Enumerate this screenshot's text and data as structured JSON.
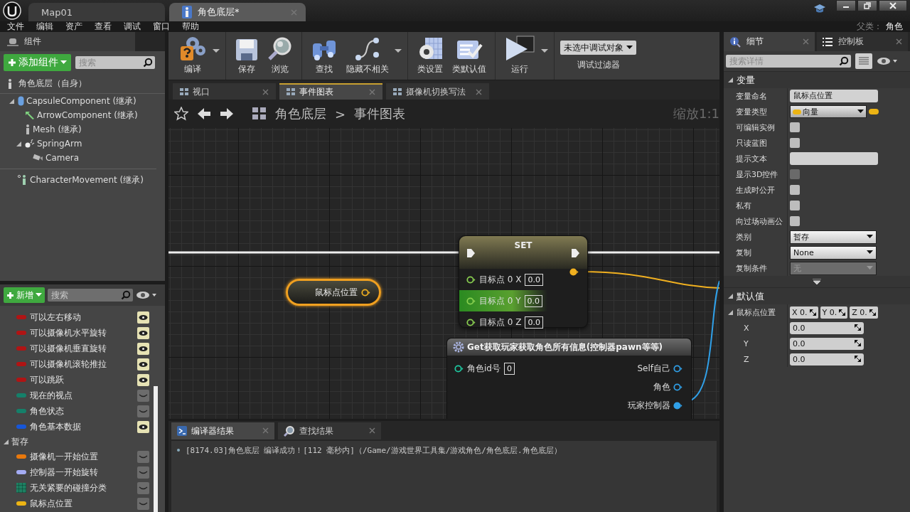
{
  "title_bar": {
    "tabs": [
      {
        "label": "Map01",
        "selected": false
      },
      {
        "label": "角色底层*",
        "selected": true
      }
    ]
  },
  "menu": {
    "items": [
      "文件",
      "编辑",
      "资产",
      "查看",
      "调试",
      "窗口",
      "帮助"
    ],
    "parent_label": "父类：",
    "parent_value": "角色"
  },
  "components": {
    "tab": "组件",
    "add_button": "添加组件",
    "search": {
      "placeholder": "搜索"
    },
    "root": "角色底层（自身）",
    "tree": [
      {
        "label": "CapsuleComponent (继承)",
        "expanded": true,
        "children": [
          {
            "label": "ArrowComponent (继承)"
          },
          {
            "label": "Mesh (继承)"
          },
          {
            "label": "SpringArm",
            "expanded": true,
            "children": [
              {
                "label": "Camera"
              }
            ]
          }
        ]
      },
      {
        "label": "CharacterMovement (继承)"
      }
    ]
  },
  "my_blueprint": {
    "add_button": "新增",
    "search": {
      "placeholder": "搜索"
    },
    "variables": [
      {
        "label": "可以左右移动",
        "kind": "pill",
        "color": "#b01414",
        "visible": true
      },
      {
        "label": "可以摄像机水平旋转",
        "kind": "pill",
        "color": "#b01414",
        "visible": true
      },
      {
        "label": "可以摄像机垂直旋转",
        "kind": "pill",
        "color": "#b01414",
        "visible": true
      },
      {
        "label": "可以摄像机滚轮推拉",
        "kind": "pill",
        "color": "#b01414",
        "visible": true
      },
      {
        "label": "可以跳跃",
        "kind": "pill",
        "color": "#b01414",
        "visible": true
      },
      {
        "label": "现在的视点",
        "kind": "pill",
        "color": "#15806a",
        "visible": false
      },
      {
        "label": "角色状态",
        "kind": "pill",
        "color": "#15806a",
        "visible": false
      },
      {
        "label": "角色基本数据",
        "kind": "pill",
        "color": "#1656d8",
        "visible": true
      }
    ],
    "categories": [
      {
        "label": "暂存",
        "expanded": true,
        "variables": [
          {
            "label": "摄像机一开始位置",
            "kind": "pill",
            "color": "#e8780c",
            "visible": false
          },
          {
            "label": "控制器一开始旋转",
            "kind": "pill",
            "color": "#a4acf4",
            "visible": false
          },
          {
            "label": "无关紧要的碰撞分类",
            "kind": "grid",
            "color": "#1e8062",
            "visible": false
          },
          {
            "label": "鼠标点位置",
            "kind": "pill",
            "color": "#ecb414",
            "visible": false
          }
        ]
      }
    ]
  },
  "toolbar": {
    "groups": [
      {
        "buttons": [
          {
            "label": "编译",
            "has_menu": true
          }
        ]
      },
      {
        "buttons": [
          {
            "label": "保存",
            "has_menu": false
          },
          {
            "label": "浏览",
            "has_menu": false
          }
        ]
      },
      {
        "buttons": [
          {
            "label": "查找",
            "has_menu": false
          },
          {
            "label": "隐藏不相关",
            "has_menu": true
          }
        ]
      },
      {
        "buttons": [
          {
            "label": "类设置",
            "has_menu": false
          },
          {
            "label": "类默认值",
            "has_menu": false
          }
        ]
      },
      {
        "buttons": [
          {
            "label": "运行",
            "has_menu": true
          }
        ]
      }
    ],
    "debug_filter": {
      "value": "未选中调试对象",
      "label": "调试过滤器"
    }
  },
  "doc_tabs": [
    {
      "label": "视口",
      "selected": false
    },
    {
      "label": "事件图表",
      "selected": true
    },
    {
      "label": "摄像机切换写法",
      "selected": false
    }
  ],
  "graph": {
    "breadcrumb": [
      "角色底层",
      "事件图表"
    ],
    "separator": ">",
    "zoom": "缩放1:1",
    "nodes": [
      {
        "kind": "variable",
        "title": "鼠标点位置",
        "selected": true
      },
      {
        "kind": "set",
        "title": "SET",
        "selected": false,
        "inputs": [
          {
            "label": "目标点 0 X",
            "value": "0.0",
            "hovered": false
          },
          {
            "label": "目标点 0 Y",
            "value": "0.0",
            "hovered": true
          },
          {
            "label": "目标点 0 Z",
            "value": "0.0",
            "hovered": false
          }
        ]
      },
      {
        "kind": "function",
        "title": "Get获取玩家获取角色所有信息(控制器pawn等等)",
        "selected": false,
        "inputs": [
          {
            "label": "角色id号",
            "value": "0"
          }
        ],
        "outputs": [
          {
            "label": "Self自己",
            "connected": false
          },
          {
            "label": "角色",
            "connected": false
          },
          {
            "label": "玩家控制器",
            "connected": true
          }
        ]
      }
    ]
  },
  "results": {
    "tabs": [
      {
        "label": "编译器结果",
        "selected": true
      },
      {
        "label": "查找结果",
        "selected": false
      }
    ],
    "log": [
      "[8174.03]角色底层 编译成功！[112 毫秒内]（/Game/游戏世界工具集/游戏角色/角色底层.角色底层）"
    ]
  },
  "details": {
    "tabs": [
      {
        "label": "细节",
        "selected": true
      },
      {
        "label": "控制板",
        "selected": false
      }
    ],
    "search": {
      "placeholder": "搜索详情"
    },
    "sections": [
      {
        "title": "变量",
        "expanded": true,
        "rows": [
          {
            "kind": "text",
            "label": "变量命名",
            "value": "鼠标点位置"
          },
          {
            "kind": "type",
            "label": "变量类型",
            "value": "向量"
          },
          {
            "kind": "checkbox",
            "label": "可编辑实例",
            "checked": false,
            "disabled": false
          },
          {
            "kind": "checkbox",
            "label": "只读蓝图",
            "checked": false,
            "disabled": false
          },
          {
            "kind": "text",
            "label": "提示文本"
          },
          {
            "kind": "checkbox",
            "label": "显示3D控件",
            "checked": false,
            "disabled": true
          },
          {
            "kind": "checkbox",
            "label": "生成时公开",
            "checked": false,
            "disabled": false
          },
          {
            "kind": "checkbox",
            "label": "私有",
            "checked": false,
            "disabled": false
          },
          {
            "kind": "checkbox",
            "label": "向过场动画公",
            "checked": false,
            "disabled": false
          },
          {
            "kind": "combo",
            "label": "类别",
            "value": "暂存",
            "disabled": false
          },
          {
            "kind": "combo",
            "label": "复制",
            "value": "None",
            "disabled": false
          },
          {
            "kind": "combo",
            "label": "复制条件",
            "value": "无",
            "disabled": true
          }
        ]
      },
      {
        "title": "默认值",
        "expanded": true,
        "rows": [
          {
            "kind": "vector",
            "label": "鼠标点位置",
            "expanded": true,
            "chips": [
              {
                "axis": "X",
                "value": "0."
              },
              {
                "axis": "Y",
                "value": "0."
              },
              {
                "axis": "Z",
                "value": "0."
              }
            ],
            "children": [
              {
                "label": "X",
                "value": "0.0"
              },
              {
                "label": "Y",
                "value": "0.0"
              },
              {
                "label": "Z",
                "value": "0.0"
              }
            ]
          }
        ]
      }
    ]
  }
}
